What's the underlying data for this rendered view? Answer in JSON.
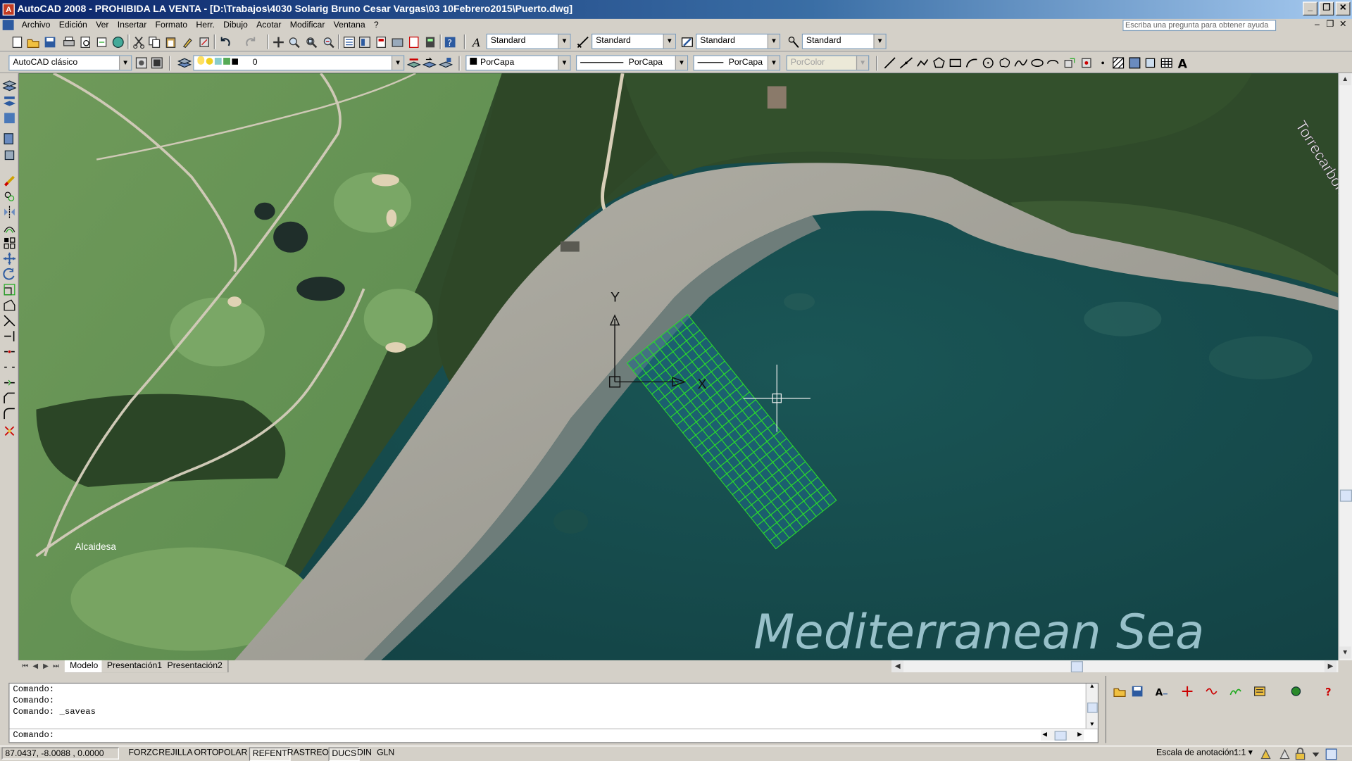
{
  "window": {
    "title": "AutoCAD 2008 - PROHIBIDA LA VENTA - [D:\\Trabajos\\4030 Solarig Bruno Cesar Vargas\\03 10Febrero2015\\Puerto.dwg]",
    "minimize": "0",
    "restore": "1",
    "close": "r"
  },
  "menu": {
    "items": [
      "Archivo",
      "Edición",
      "Ver",
      "Insertar",
      "Formato",
      "Herr.",
      "Dibujo",
      "Acotar",
      "Modificar",
      "Ventana",
      "?"
    ],
    "help_placeholder": "Escriba una pregunta para obtener ayuda"
  },
  "styles_toolbar": {
    "text_style": "Standard",
    "dim_style": "Standard",
    "table_style": "Standard",
    "multileader_style": "Standard"
  },
  "properties_toolbar": {
    "workspace": "AutoCAD clásico",
    "layer": "0",
    "color": "PorCapa",
    "linetype": "PorCapa",
    "lineweight": "PorCapa",
    "plotstyle": "PorColor"
  },
  "drawing": {
    "map_labels": {
      "sea": "Mediterranean Sea",
      "town": "Alcaidesa",
      "place": "Torrecarbonera"
    },
    "ucs": {
      "x_label": "X",
      "y_label": "Y"
    },
    "grid": {
      "rows": 9,
      "cols": 24,
      "color": "#2bd82b"
    }
  },
  "layout_tabs": {
    "tabs": [
      "Modelo",
      "Presentación1",
      "Presentación2"
    ],
    "active": "Modelo"
  },
  "command": {
    "history": [
      "Comando:",
      "Comando:",
      "Comando: _saveas"
    ],
    "prompt": "Comando:"
  },
  "status": {
    "coords": "87.0437, -8.0088 , 0.0000",
    "toggles": [
      {
        "label": "FORZC",
        "on": false
      },
      {
        "label": "REJILLA",
        "on": false
      },
      {
        "label": "ORTO",
        "on": false
      },
      {
        "label": "POLAR",
        "on": false
      },
      {
        "label": "REFENT",
        "on": true
      },
      {
        "label": "RASTREO",
        "on": false
      },
      {
        "label": "DUCS",
        "on": true
      },
      {
        "label": "DIN",
        "on": false
      },
      {
        "label": "GLN",
        "on": false
      }
    ],
    "annotation_scale_label": "Escala de anotación:",
    "annotation_scale": "1:1"
  },
  "colors": {
    "title_start": "#0a246a",
    "title_end": "#a6caf0",
    "grid_green": "#2bd82b",
    "sea": "#1d4f4e"
  }
}
